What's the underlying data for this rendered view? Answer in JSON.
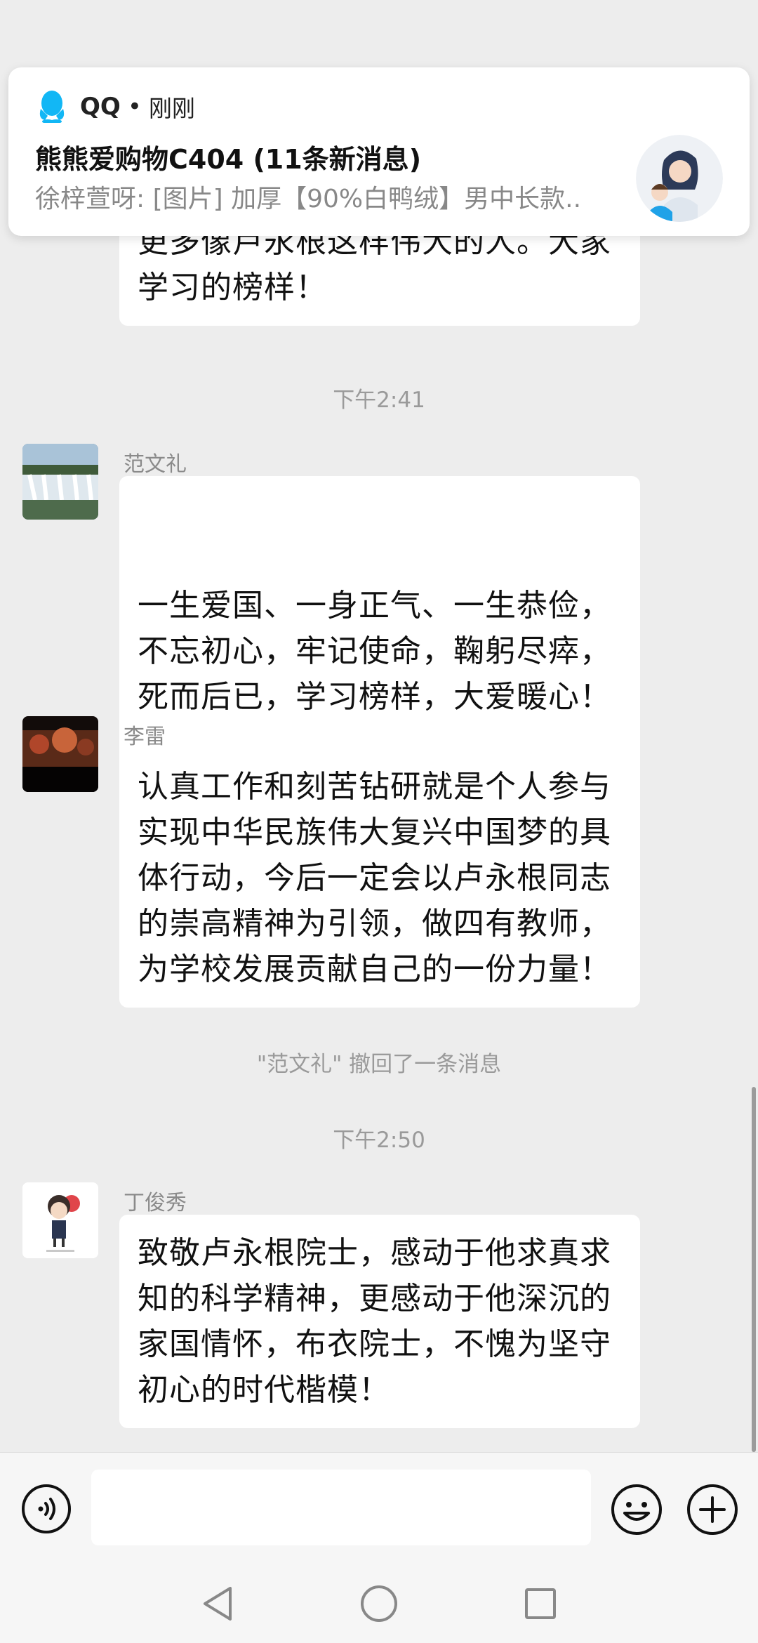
{
  "notification": {
    "app_name": "QQ",
    "separator": "•",
    "time": "刚刚",
    "title": "熊熊爱购物C404 (11条新消息)",
    "preview": "徐梓萱呀: [图片] 加厚【90%白鸭绒】男中长款.."
  },
  "messages": [
    {
      "text": "更多像卢永根这样伟大的人。大家\n学习的榜样！"
    },
    {
      "timestamp": "下午2:41"
    },
    {
      "sender": "范文礼",
      "text": "一生爱国、一身正气、一生恭俭，\n不忘初心，牢记使命，鞠躬尽瘁，\n死而后已，学习榜样，大爱暖心！",
      "emoji": "✊✊"
    },
    {
      "sender": "李雷",
      "text": "认真工作和刻苦钻研就是个人参与\n实现中华民族伟大复兴中国梦的具\n体行动，今后一定会以卢永根同志\n的崇高精神为引领，做四有教师，\n为学校发展贡献自己的一份力量！"
    },
    {
      "system": "\"范文礼\" 撤回了一条消息"
    },
    {
      "timestamp": "下午2:50"
    },
    {
      "sender": "丁俊秀",
      "text": "致敬卢永根院士，感动于他求真求\n知的科学精神，更感动于他深沉的\n家国情怀，布衣院士，不愧为坚守\n初心的时代楷模！"
    }
  ],
  "icons": {
    "voice": "voice-icon",
    "emoji": "emoji-icon",
    "plus": "plus-icon",
    "back": "back-nav-icon",
    "home": "home-nav-icon",
    "recents": "recents-nav-icon"
  },
  "colors": {
    "background": "#ededed",
    "bubble": "#ffffff",
    "qq_blue": "#12b7f5"
  }
}
